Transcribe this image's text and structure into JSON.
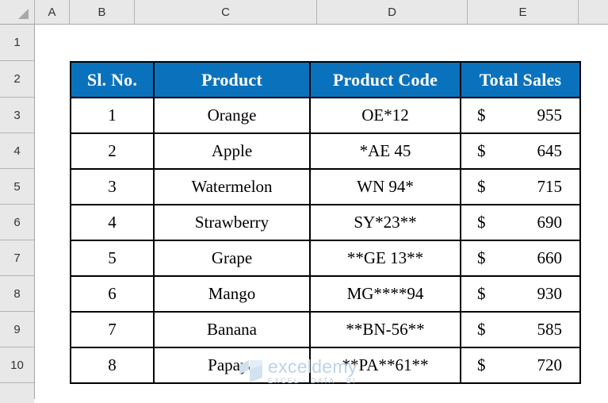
{
  "spreadsheet": {
    "column_headers": [
      "A",
      "B",
      "C",
      "D",
      "E"
    ],
    "row_headers": [
      "1",
      "2",
      "3",
      "4",
      "5",
      "6",
      "7",
      "8",
      "9",
      "10"
    ],
    "select_all_icon": "select-all-triangle"
  },
  "table": {
    "header_fill_color": "#0a72bd",
    "header_text_color": "#ffffff",
    "border_color": "#000000",
    "columns": [
      "Sl. No.",
      "Product",
      "Product Code",
      "Total Sales"
    ],
    "rows": [
      {
        "sl_no": "1",
        "product": "Orange",
        "product_code": "OE*12",
        "currency": "$",
        "total_sales": "955"
      },
      {
        "sl_no": "2",
        "product": "Apple",
        "product_code": "*AE 45",
        "currency": "$",
        "total_sales": "645"
      },
      {
        "sl_no": "3",
        "product": "Watermelon",
        "product_code": "WN 94*",
        "currency": "$",
        "total_sales": "715"
      },
      {
        "sl_no": "4",
        "product": "Strawberry",
        "product_code": "SY*23**",
        "currency": "$",
        "total_sales": "690"
      },
      {
        "sl_no": "5",
        "product": "Grape",
        "product_code": "**GE 13**",
        "currency": "$",
        "total_sales": "660"
      },
      {
        "sl_no": "6",
        "product": "Mango",
        "product_code": "MG****94",
        "currency": "$",
        "total_sales": "930"
      },
      {
        "sl_no": "7",
        "product": "Banana",
        "product_code": "**BN-56**",
        "currency": "$",
        "total_sales": "585"
      },
      {
        "sl_no": "8",
        "product": "Papaya",
        "product_code": "**PA**61**",
        "currency": "$",
        "total_sales": "720"
      }
    ]
  },
  "watermark": {
    "name": "exceldemy",
    "tagline": "EXCEL - DATA - BI",
    "logo_icon": "cube-logo-icon",
    "name_color": "#bcd4e8",
    "tagline_color": "#c3cbd2"
  }
}
